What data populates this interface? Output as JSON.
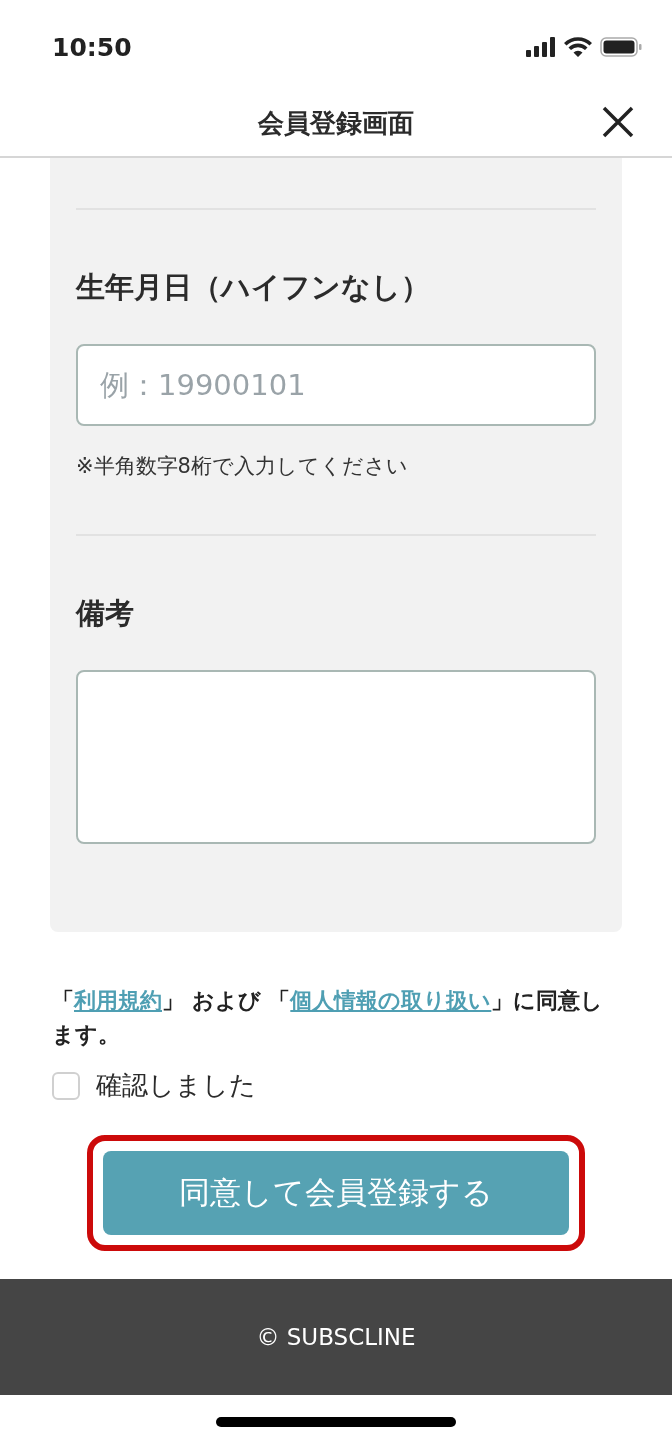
{
  "status_bar": {
    "time": "10:50"
  },
  "header": {
    "title": "会員登録画面"
  },
  "form": {
    "fields": [
      {
        "kind": "input",
        "label": "生年月日（ハイフンなし）",
        "placeholder": "例：19900101",
        "note": "※半角数字8桁で入力してください"
      },
      {
        "kind": "textarea",
        "label": "備考"
      }
    ]
  },
  "consent": {
    "parts": [
      {
        "kind": "text",
        "text": "「"
      },
      {
        "kind": "link",
        "text": "利用規約"
      },
      {
        "kind": "text",
        "text": "」 および 「"
      },
      {
        "kind": "link",
        "text": "個人情報の取り扱い"
      },
      {
        "kind": "text",
        "text": "」に同意します。"
      }
    ],
    "checkbox": {
      "label": "確認しました",
      "checked": false
    }
  },
  "submit": {
    "label": "同意して会員登録する",
    "highlighted": true
  },
  "footer": {
    "text": "© SUBSCLINE"
  }
}
